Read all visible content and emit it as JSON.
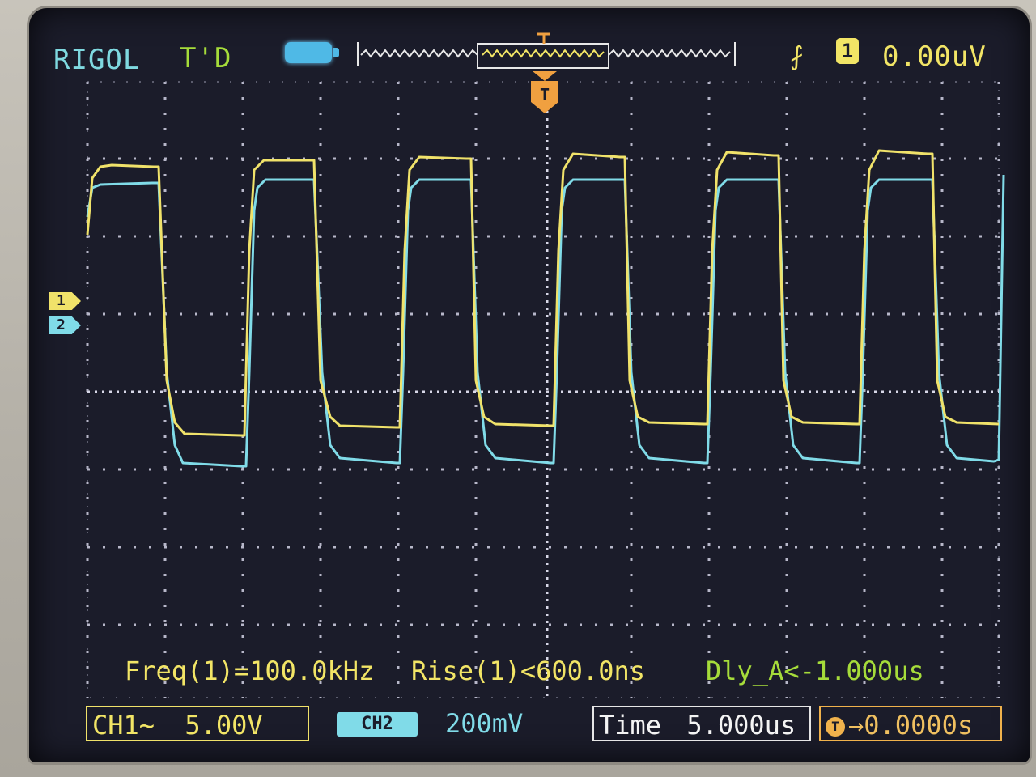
{
  "header": {
    "brand": "RIGOL",
    "mode": "T'D",
    "trigger_slope_symbol": "⨏",
    "trigger_source": "1",
    "trigger_level": "0.00uV"
  },
  "trigger_marker": "T",
  "channel_markers": {
    "ch1": "1",
    "ch2": "2"
  },
  "measurements": {
    "freq": "Freq(1)=100.0kHz",
    "rise": "Rise(1)<600.0ns",
    "delay": "Dly_A<-1.000us"
  },
  "status": {
    "ch1_label": "CH1~",
    "ch1_scale": "5.00V",
    "ch2_coupling": "CH2",
    "ch2_scale": "200mV",
    "time_label": "Time",
    "time_scale": "5.000us",
    "trigger_offset_icon": "T",
    "trigger_offset": "→0.0000s"
  },
  "colors": {
    "ch1": "#f0e26a",
    "ch2": "#80dbe8",
    "grid": "#d8d8e8",
    "trigger": "#f0a040",
    "screen_bg": "#1b1c2a"
  },
  "icons": {
    "battery": "battery-icon",
    "memory": "memory-waveform-icon",
    "trigger_edge": "rising-edge-icon"
  }
}
